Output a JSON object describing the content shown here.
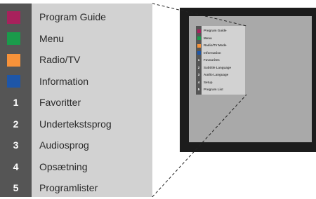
{
  "callout_menu": {
    "items": [
      {
        "marker": "",
        "color": "#a8215c",
        "label": "Program Guide"
      },
      {
        "marker": "",
        "color": "#1a9b4b",
        "label": "Menu"
      },
      {
        "marker": "",
        "color": "#f7923a",
        "label": "Radio/TV"
      },
      {
        "marker": "",
        "color": "#1e56a8",
        "label": "Information"
      },
      {
        "marker": "1",
        "color": "",
        "label": "Favoritter"
      },
      {
        "marker": "2",
        "color": "",
        "label": "Undertekstsprog"
      },
      {
        "marker": "3",
        "color": "",
        "label": "Audiosprog"
      },
      {
        "marker": "4",
        "color": "",
        "label": "Opsætning"
      },
      {
        "marker": "5",
        "color": "",
        "label": "Programlister"
      }
    ]
  },
  "screen_menu": {
    "items": [
      {
        "marker": "",
        "color": "#a8215c",
        "label": "Program Guide"
      },
      {
        "marker": "",
        "color": "#1a9b4b",
        "label": "Menu"
      },
      {
        "marker": "",
        "color": "#f7923a",
        "label": "Radio/TV Mode"
      },
      {
        "marker": "",
        "color": "#1e56a8",
        "label": "Information"
      },
      {
        "marker": "1",
        "color": "",
        "label": "Favourites"
      },
      {
        "marker": "2",
        "color": "",
        "label": "Subtitle Language"
      },
      {
        "marker": "3",
        "color": "",
        "label": "Audio Language"
      },
      {
        "marker": "4",
        "color": "",
        "label": "Setup"
      },
      {
        "marker": "5",
        "color": "",
        "label": "Program List"
      }
    ]
  }
}
